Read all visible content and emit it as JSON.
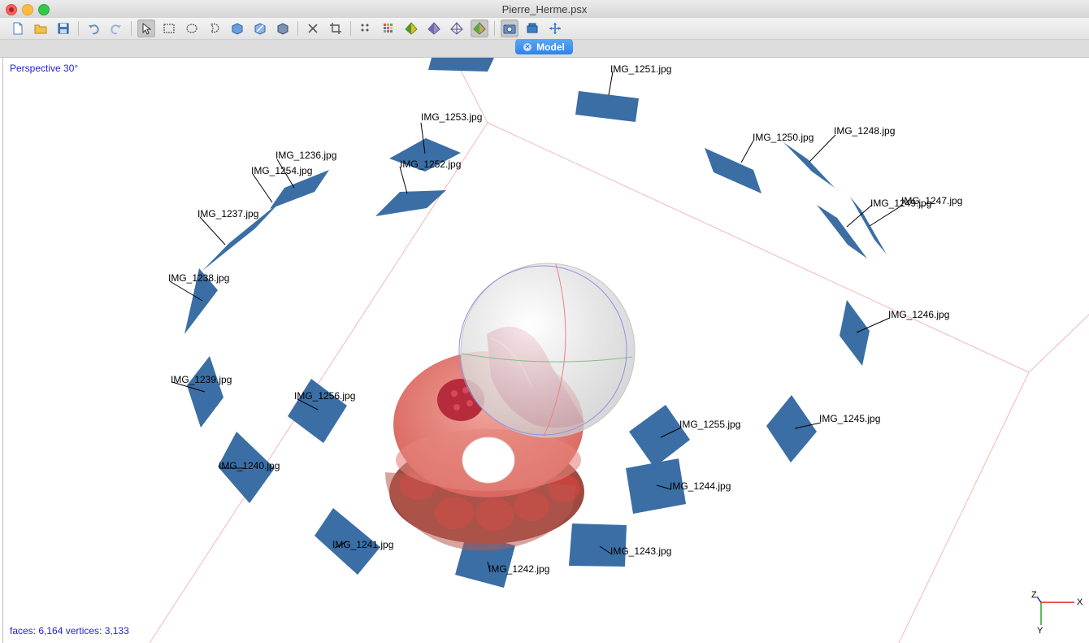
{
  "window": {
    "title": "Pierre_Herme.psx"
  },
  "toolbar": {
    "buttons": [
      {
        "name": "new-document-icon"
      },
      {
        "name": "open-folder-icon"
      },
      {
        "name": "save-icon"
      },
      {
        "name": "undo-icon"
      },
      {
        "name": "redo-icon"
      },
      {
        "name": "navigation-cursor-icon"
      },
      {
        "name": "rectangle-selection-icon"
      },
      {
        "name": "circle-selection-icon"
      },
      {
        "name": "free-form-selection-icon"
      },
      {
        "name": "rotate-object-icon"
      },
      {
        "name": "move-object-icon"
      },
      {
        "name": "scale-object-icon"
      },
      {
        "name": "delete-selection-icon"
      },
      {
        "name": "crop-selection-icon"
      },
      {
        "name": "point-cloud-icon"
      },
      {
        "name": "dense-cloud-icon"
      },
      {
        "name": "shaded-model-icon"
      },
      {
        "name": "solid-model-icon"
      },
      {
        "name": "wireframe-model-icon"
      },
      {
        "name": "textured-model-icon"
      },
      {
        "name": "show-cameras-icon"
      },
      {
        "name": "show-region-icon"
      },
      {
        "name": "reset-view-icon"
      }
    ]
  },
  "tab": {
    "label": "Model"
  },
  "viewport": {
    "projection_label": "Perspective 30°",
    "stats_label": "faces: 6,164 vertices: 3,133",
    "axes": {
      "x": "X",
      "y": "Y",
      "z": "Z"
    },
    "camera_labels": [
      "IMG_1251.jpg",
      "IMG_1253.jpg",
      "IMG_1252.jpg",
      "IMG_1250.jpg",
      "IMG_1248.jpg",
      "IMG_1249.jpg",
      "IMG_1247.jpg",
      "IMG_1236.jpg",
      "IMG_1254.jpg",
      "IMG_1237.jpg",
      "IMG_1238.jpg",
      "IMG_1246.jpg",
      "IMG_1239.jpg",
      "IMG_1256.jpg",
      "IMG_1255.jpg",
      "IMG_1245.jpg",
      "IMG_1240.jpg",
      "IMG_1244.jpg",
      "IMG_1241.jpg",
      "IMG_1243.jpg",
      "IMG_1242.jpg"
    ],
    "camera_color": "#3a6ea5"
  }
}
